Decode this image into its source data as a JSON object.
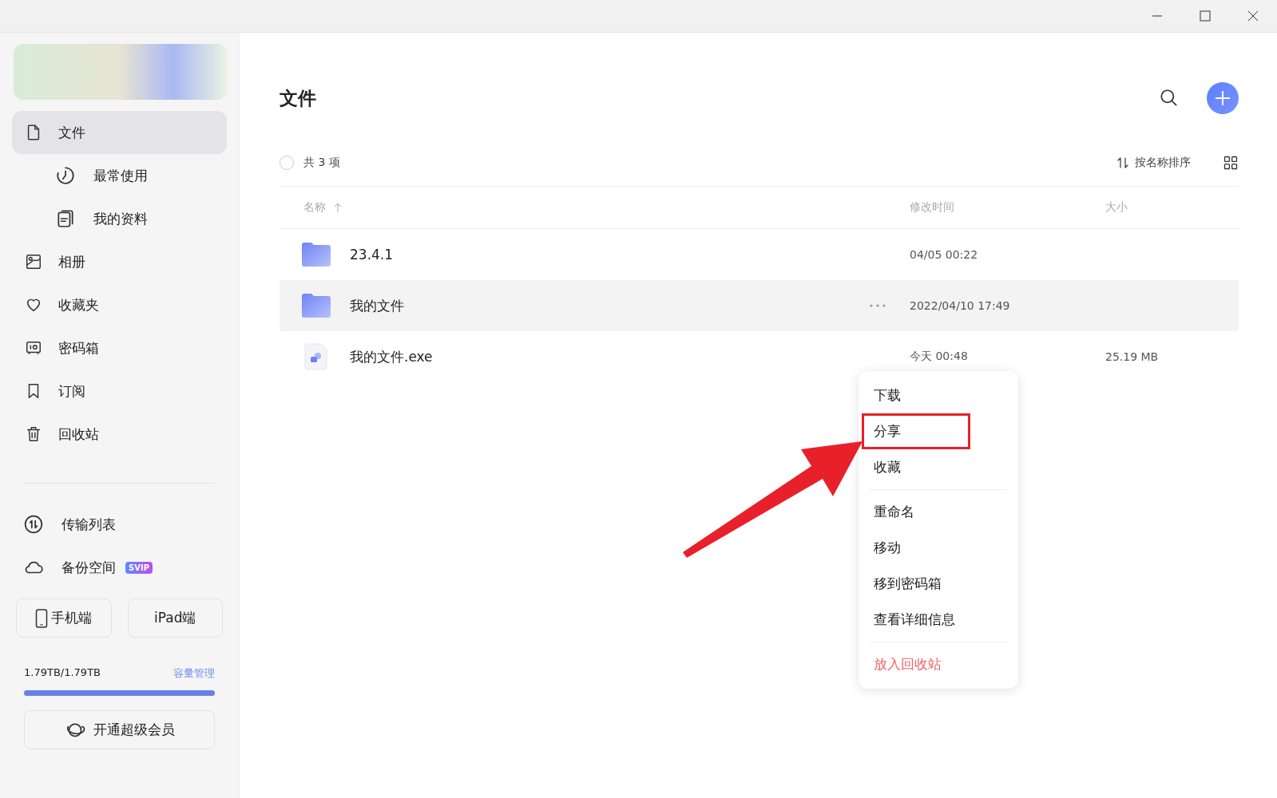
{
  "sidebar": {
    "nav": [
      {
        "label": "文件",
        "selected": true,
        "children": [
          {
            "label": "最常使用",
            "selected": false
          },
          {
            "label": "我的资料",
            "selected": false
          }
        ]
      },
      {
        "label": "相册",
        "selected": false
      },
      {
        "label": "收藏夹",
        "selected": false
      },
      {
        "label": "密码箱",
        "selected": false
      },
      {
        "label": "订阅",
        "selected": false
      },
      {
        "label": "回收站",
        "selected": false
      }
    ],
    "tools": [
      {
        "label": "传输列表"
      },
      {
        "label": "备份空间",
        "badge": "SVIP"
      }
    ],
    "device_buttons": [
      "手机端",
      "iPad端"
    ],
    "storage": {
      "usage": "1.79TB/1.79TB",
      "manage_link": "容量管理",
      "level": 1
    },
    "vip_button": "开通超级会员"
  },
  "main": {
    "title": "文件",
    "count": "共 3 项",
    "all_selected": false,
    "sort": "按名称排序",
    "columns": [
      "名称",
      "修改时间",
      "大小"
    ],
    "rows": [
      {
        "kind": "folder",
        "name": "23.4.1",
        "modified": "04/05 00:22",
        "selected": false
      },
      {
        "kind": "folder",
        "name": "我的文件",
        "modified": "2022/04/10 17:49",
        "selected": true
      },
      {
        "kind": "file",
        "name": "我的文件.exe",
        "modified": "今天 00:48",
        "size": "25.19 MB",
        "selected": false
      }
    ]
  },
  "context_menu": {
    "groups": [
      [
        {
          "label": "下载",
          "kind": "normal",
          "highlighted": false
        },
        {
          "label": "分享",
          "kind": "normal",
          "highlighted": true
        },
        {
          "label": "收藏",
          "kind": "normal",
          "highlighted": false
        }
      ],
      [
        {
          "label": "重命名",
          "kind": "normal",
          "highlighted": false
        },
        {
          "label": "移动",
          "kind": "normal",
          "highlighted": false
        },
        {
          "label": "移到密码箱",
          "kind": "normal",
          "highlighted": false
        },
        {
          "label": "查看详细信息",
          "kind": "normal",
          "highlighted": false
        }
      ],
      [
        {
          "label": "放入回收站",
          "kind": "danger",
          "highlighted": false
        }
      ]
    ]
  }
}
